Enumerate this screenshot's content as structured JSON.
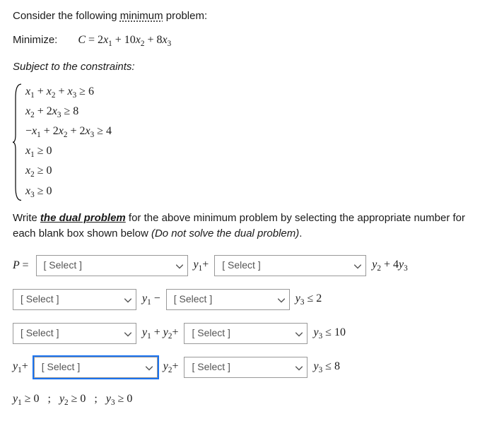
{
  "intro": {
    "prefix": "Consider the following ",
    "keyword": "minimum",
    "suffix": " problem:"
  },
  "minimize": {
    "label": "Minimize:",
    "expr": "C = 2x₁ + 10x₂ + 8x₃"
  },
  "subject_label": "Subject to the constraints:",
  "constraints": [
    "x₁ + x₂ + x₃ ≥ 6",
    "x₂ + 2x₃ ≥ 8",
    "−x₁ + 2x₂ + 2x₃ ≥ 4",
    "x₁ ≥ 0",
    "x₂ ≥ 0",
    "x₃ ≥ 0"
  ],
  "instruction": {
    "pre": "Write ",
    "emph": "the dual problem",
    "mid": " for the above minimum problem by selecting the appropriate number for each blank box shown below ",
    "post": "(Do not solve the dual problem)",
    "end": "."
  },
  "select_placeholder": "[ Select ]",
  "rows": {
    "r1": {
      "lead": "P =",
      "tail": "y₂ + 4y₃",
      "mid": "y₁+"
    },
    "r2": {
      "mid": "y₁ −",
      "tail": "y₃ ≤ 2"
    },
    "r3": {
      "mid": "y₁ + y₂+",
      "tail": "y₃ ≤ 10"
    },
    "r4": {
      "lead": "y₁+",
      "mid": "y₂+",
      "tail": "y₃ ≤ 8"
    }
  },
  "nonneg": "y₁ ≥ 0    ;    y₂ ≥ 0    ;    y₃ ≥ 0",
  "chart_data": {
    "type": "table",
    "title": "Dual problem construction (fill-in)",
    "primal": {
      "objective": "Minimize C = 2x1 + 10x2 + 8x3",
      "constraints": [
        "x1 + x2 + x3 >= 6",
        "x2 + 2x3 >= 8",
        "-x1 + 2x2 + 2x3 >= 4",
        "x1 >= 0",
        "x2 >= 0",
        "x3 >= 0"
      ]
    },
    "dual_template": [
      "P = [Select] y1 + [Select] y2 + 4 y3",
      "[Select] y1 - [Select] y3 <= 2",
      "[Select] y1 + y2 + [Select] y3 <= 10",
      "y1 + [Select] y2 + [Select] y3 <= 8",
      "y1 >= 0 ; y2 >= 0 ; y3 >= 0"
    ]
  }
}
